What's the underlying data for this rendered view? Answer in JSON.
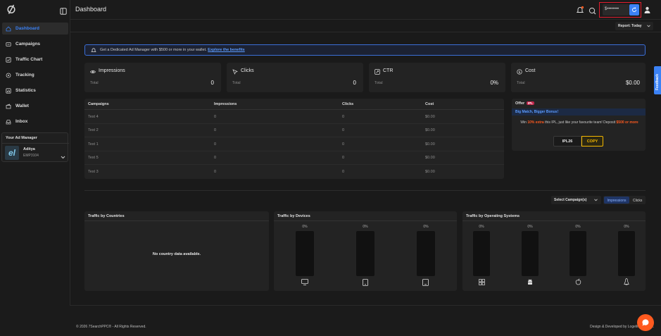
{
  "header": {
    "title": "Dashboard",
    "balance": "$••••••••"
  },
  "sidebar": {
    "items": [
      {
        "label": "Dashboard",
        "icon": "home-icon"
      },
      {
        "label": "Campaigns",
        "icon": "campaign-icon"
      },
      {
        "label": "Traffic Chart",
        "icon": "chart-icon"
      },
      {
        "label": "Tracking",
        "icon": "tracking-icon"
      },
      {
        "label": "Statistics",
        "icon": "statistics-icon"
      },
      {
        "label": "Wallet",
        "icon": "wallet-icon"
      },
      {
        "label": "Inbox",
        "icon": "inbox-icon"
      }
    ],
    "manager": {
      "heading": "Your Ad Manager",
      "name": "Aditya",
      "id": "EMP3104",
      "initials": "el"
    }
  },
  "report": {
    "label": "Report: Today"
  },
  "banner": {
    "text": "Get a Dedicated Ad Manager with $500 or more in your wallet.",
    "link": "Explore the benefits"
  },
  "metrics": [
    {
      "title": "Impressions",
      "sub": "Total",
      "value": "0",
      "icon": "eye-icon"
    },
    {
      "title": "Clicks",
      "sub": "Total",
      "value": "0",
      "icon": "click-icon"
    },
    {
      "title": "CTR",
      "sub": "Total",
      "value": "0%",
      "icon": "ctr-icon"
    },
    {
      "title": "Cost",
      "sub": "Total",
      "value": "$0.00",
      "icon": "cost-icon"
    }
  ],
  "table": {
    "headers": [
      "Campaigns",
      "Impressions",
      "Clicks",
      "Cost"
    ],
    "rows": [
      [
        "Test 4",
        "0",
        "0",
        "$0.00"
      ],
      [
        "Test 2",
        "0",
        "0",
        "$0.00"
      ],
      [
        "Test 1",
        "0",
        "0",
        "$0.00"
      ],
      [
        "Test 5",
        "0",
        "0",
        "$0.00"
      ],
      [
        "Test 3",
        "0",
        "0",
        "$0.00"
      ]
    ]
  },
  "offer": {
    "label": "Offer",
    "badge": "IPL",
    "title": "Big Match, Bigger Bonus!",
    "text_pre": "Win ",
    "highlight1": "10% extra",
    "text_mid": " this IPL, just like your favourite team! Deposit ",
    "highlight2": "$500 or more",
    "code": "IPL26",
    "copy": "COPY"
  },
  "feedback": "Feedback",
  "filter": {
    "select": "Select Campaign(s)",
    "tab_impressions": "Impressions",
    "tab_clicks": "Clicks"
  },
  "panels": {
    "countries": {
      "title": "Traffic by Countries",
      "empty": "No country data available."
    },
    "devices": {
      "title": "Traffic by Devices",
      "items": [
        {
          "pct": 0,
          "label": "0%",
          "icon": "desktop-icon"
        },
        {
          "pct": 0,
          "label": "0%",
          "icon": "mobile-icon"
        },
        {
          "pct": 0,
          "label": "0%",
          "icon": "tablet-icon"
        }
      ]
    },
    "os": {
      "title": "Traffic by Operating Systems",
      "items": [
        {
          "pct": 0,
          "label": "0%",
          "icon": "windows-icon"
        },
        {
          "pct": 0,
          "label": "0%",
          "icon": "android-icon"
        },
        {
          "pct": 0,
          "label": "0%",
          "icon": "apple-icon"
        },
        {
          "pct": 0,
          "label": "0%",
          "icon": "linux-icon"
        }
      ]
    }
  },
  "footer": {
    "copyright": "© 2026 7SearchPPC® - All Rights Reserved.",
    "credit": "Design & Developed by Logelite Pvt. Ltd."
  },
  "colors": {
    "accent": "#3b82f6",
    "highlight": "#ff5a1f",
    "gold": "#f5b800",
    "bg": "#1a1a1a",
    "card": "#232323"
  }
}
